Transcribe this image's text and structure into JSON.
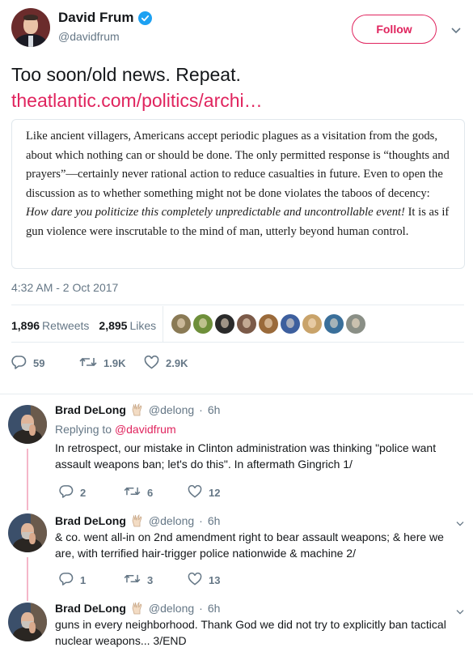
{
  "main_tweet": {
    "name": "David Frum",
    "handle": "@davidfrum",
    "follow_label": "Follow",
    "text_line": "Too soon/old news. Repeat.",
    "link": "theatlantic.com/politics/archi…",
    "quote": {
      "part1": "Like ancient villagers, Americans accept periodic plagues as a visitation from the gods, about which nothing can or should be done. The only permitted response is “thoughts and prayers”—certainly never rational action to reduce casualties in future. Even to open the discussion as to whether something might not be done violates the taboos of decency: ",
      "emphasis": "How dare you politicize this completely unpredictable and uncontrollable event!",
      "part2": " It is as if gun violence were inscrutable to the mind of man, utterly beyond human control."
    },
    "timestamp": "4:32 AM - 2 Oct 2017",
    "retweets_count": "1,896",
    "retweets_label": "Retweets",
    "likes_count": "2,895",
    "likes_label": "Likes",
    "liker_colors": [
      "#8a7a55",
      "#6e8f3a",
      "#2a2a2a",
      "#7b5a48",
      "#9a6a3a",
      "#3d5f9e",
      "#c9a36a",
      "#3a6f9a",
      "#8a8f86"
    ],
    "actions": {
      "replies": "59",
      "retweets": "1.9K",
      "likes": "2.9K"
    }
  },
  "replies": [
    {
      "name": "Brad DeLong",
      "handle": "@delong",
      "time": "6h",
      "replying_to_label": "Replying to",
      "replying_to": "@davidfrum",
      "text": "In retrospect, our mistake in Clinton administration was thinking \"police want assault weapons ban; let's do this\". In aftermath Gingrich 1/",
      "replies": "2",
      "retweets": "6",
      "likes": "12"
    },
    {
      "name": "Brad DeLong",
      "handle": "@delong",
      "time": "6h",
      "text": "& co. went all-in on 2nd amendment right to bear assault weapons; & here we are, with terrified hair-trigger police nationwide & machine 2/",
      "replies": "1",
      "retweets": "3",
      "likes": "13"
    },
    {
      "name": "Brad DeLong",
      "handle": "@delong",
      "time": "6h",
      "text": "guns in every neighborhood. Thank God we did not try to explicitly ban tactical nuclear weapons... 3/END"
    }
  ],
  "colors": {
    "accent": "#e0245e",
    "verified": "#1da1f2",
    "muted": "#657786",
    "thread": "#f4b7c9"
  }
}
